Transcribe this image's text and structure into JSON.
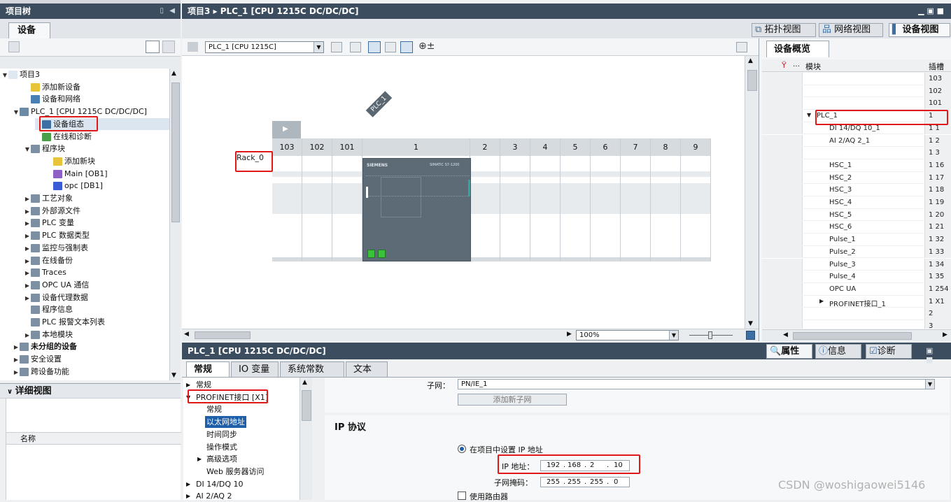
{
  "project_tree": {
    "title": "项目树",
    "tab": "设备",
    "items": [
      {
        "label": "项目3",
        "depth": 0,
        "toggle": "▼",
        "icon": "#dfe7f1"
      },
      {
        "label": "添加新设备",
        "depth": 2,
        "toggle": "",
        "icon": "#e8c43a"
      },
      {
        "label": "设备和网络",
        "depth": 2,
        "toggle": "",
        "icon": "#4a7fb3"
      },
      {
        "label": "PLC_1 [CPU 1215C DC/DC/DC]",
        "depth": 1,
        "toggle": "▼",
        "icon": "#6b8aa6"
      },
      {
        "label": "设备组态",
        "depth": 3,
        "toggle": "",
        "icon": "#3d6fa3"
      },
      {
        "label": "在线和诊断",
        "depth": 3,
        "toggle": "",
        "icon": "#4aa04a"
      },
      {
        "label": "程序块",
        "depth": 2,
        "toggle": "▼",
        "icon": "#7d8fa2"
      },
      {
        "label": "添加新块",
        "depth": 4,
        "toggle": "",
        "icon": "#e8c43a"
      },
      {
        "label": "Main [OB1]",
        "depth": 4,
        "toggle": "",
        "icon": "#8e5fc7"
      },
      {
        "label": "opc [DB1]",
        "depth": 4,
        "toggle": "",
        "icon": "#3b5bd6"
      },
      {
        "label": "工艺对象",
        "depth": 2,
        "toggle": "▶",
        "icon": "#7d8fa2"
      },
      {
        "label": "外部源文件",
        "depth": 2,
        "toggle": "▶",
        "icon": "#7d8fa2"
      },
      {
        "label": "PLC 变量",
        "depth": 2,
        "toggle": "▶",
        "icon": "#7d8fa2"
      },
      {
        "label": "PLC 数据类型",
        "depth": 2,
        "toggle": "▶",
        "icon": "#7d8fa2"
      },
      {
        "label": "监控与强制表",
        "depth": 2,
        "toggle": "▶",
        "icon": "#7d8fa2"
      },
      {
        "label": "在线备份",
        "depth": 2,
        "toggle": "▶",
        "icon": "#7d8fa2"
      },
      {
        "label": "Traces",
        "depth": 2,
        "toggle": "▶",
        "icon": "#7d8fa2"
      },
      {
        "label": "OPC UA 通信",
        "depth": 2,
        "toggle": "▶",
        "icon": "#7d8fa2"
      },
      {
        "label": "设备代理数据",
        "depth": 2,
        "toggle": "▶",
        "icon": "#7d8fa2"
      },
      {
        "label": "程序信息",
        "depth": 2,
        "toggle": "",
        "icon": "#7d8fa2"
      },
      {
        "label": "PLC 报警文本列表",
        "depth": 2,
        "toggle": "",
        "icon": "#7d8fa2"
      },
      {
        "label": "本地模块",
        "depth": 2,
        "toggle": "▶",
        "icon": "#7d8fa2"
      },
      {
        "label": "未分组的设备",
        "depth": 1,
        "toggle": "▶",
        "icon": "#7d8fa2",
        "bold": true
      },
      {
        "label": "安全设置",
        "depth": 1,
        "toggle": "▶",
        "icon": "#7d8fa2"
      },
      {
        "label": "跨设备功能",
        "depth": 1,
        "toggle": "▶",
        "icon": "#7d8fa2"
      }
    ]
  },
  "detail_view": {
    "title": "详细视图",
    "column_name": "名称"
  },
  "editor": {
    "title": "项目3 ▸ PLC_1 [CPU 1215C DC/DC/DC]",
    "views": [
      "拓扑视图",
      "网络视图",
      "设备视图"
    ],
    "device_select": "PLC_1 [CPU 1215C]",
    "plc_tag": "PLC_1",
    "rack_label": "Rack_0",
    "slots": [
      "103",
      "102",
      "101",
      "1",
      "2",
      "3",
      "4",
      "5",
      "6",
      "7",
      "8",
      "9"
    ],
    "zoom": "100%",
    "cpu_brand": "SIEMENS",
    "cpu_model": "SIMATIC S7-1200"
  },
  "overview": {
    "tab": "设备概览",
    "col_module": "模块",
    "col_slot": "插槽",
    "rows": [
      {
        "module": "",
        "slot": "103",
        "indent": 0,
        "toggle": ""
      },
      {
        "module": "",
        "slot": "102",
        "indent": 0,
        "toggle": ""
      },
      {
        "module": "",
        "slot": "101",
        "indent": 0,
        "toggle": ""
      },
      {
        "module": "PLC_1",
        "slot": "1",
        "indent": 0,
        "toggle": "▼"
      },
      {
        "module": "DI 14/DQ 10_1",
        "slot": "1 1",
        "indent": 1,
        "toggle": ""
      },
      {
        "module": "AI 2/AQ 2_1",
        "slot": "1 2",
        "indent": 1,
        "toggle": ""
      },
      {
        "module": "",
        "slot": "1 3",
        "indent": 1,
        "toggle": ""
      },
      {
        "module": "HSC_1",
        "slot": "1 16",
        "indent": 1,
        "toggle": ""
      },
      {
        "module": "HSC_2",
        "slot": "1 17",
        "indent": 1,
        "toggle": ""
      },
      {
        "module": "HSC_3",
        "slot": "1 18",
        "indent": 1,
        "toggle": ""
      },
      {
        "module": "HSC_4",
        "slot": "1 19",
        "indent": 1,
        "toggle": ""
      },
      {
        "module": "HSC_5",
        "slot": "1 20",
        "indent": 1,
        "toggle": ""
      },
      {
        "module": "HSC_6",
        "slot": "1 21",
        "indent": 1,
        "toggle": ""
      },
      {
        "module": "Pulse_1",
        "slot": "1 32",
        "indent": 1,
        "toggle": ""
      },
      {
        "module": "Pulse_2",
        "slot": "1 33",
        "indent": 1,
        "toggle": ""
      },
      {
        "module": "Pulse_3",
        "slot": "1 34",
        "indent": 1,
        "toggle": ""
      },
      {
        "module": "Pulse_4",
        "slot": "1 35",
        "indent": 1,
        "toggle": ""
      },
      {
        "module": "OPC UA",
        "slot": "1 254",
        "indent": 1,
        "toggle": ""
      },
      {
        "module": "PROFINET接口_1",
        "slot": "1 X1",
        "indent": 1,
        "toggle": "▶"
      },
      {
        "module": "",
        "slot": "2",
        "indent": 0,
        "toggle": ""
      },
      {
        "module": "",
        "slot": "3",
        "indent": 0,
        "toggle": ""
      }
    ]
  },
  "properties": {
    "title": "PLC_1 [CPU 1215C DC/DC/DC]",
    "right_tabs": [
      "属性",
      "信息",
      "诊断"
    ],
    "tabs": [
      "常规",
      "IO 变量",
      "系统常数",
      "文本"
    ],
    "nav": [
      {
        "label": "常规",
        "indent": 0,
        "toggle": "▶"
      },
      {
        "label": "PROFINET接口 [X1]",
        "indent": 0,
        "toggle": "▼"
      },
      {
        "label": "常规",
        "indent": 1,
        "toggle": ""
      },
      {
        "label": "以太网地址",
        "indent": 1,
        "toggle": "",
        "selected": true
      },
      {
        "label": "时间同步",
        "indent": 1,
        "toggle": ""
      },
      {
        "label": "操作模式",
        "indent": 1,
        "toggle": ""
      },
      {
        "label": "高级选项",
        "indent": 1,
        "toggle": "▶"
      },
      {
        "label": "Web 服务器访问",
        "indent": 1,
        "toggle": ""
      },
      {
        "label": "DI 14/DQ 10",
        "indent": 0,
        "toggle": "▶"
      },
      {
        "label": "AI 2/AQ 2",
        "indent": 0,
        "toggle": "▶"
      }
    ],
    "subnet_label": "子网：",
    "subnet_value": "PN/IE_1",
    "add_subnet": "添加新子网",
    "ip_section": "IP 协议",
    "radio_set_ip": "在项目中设置 IP 地址",
    "ip_label": "IP 地址：",
    "ip": [
      "192",
      "168",
      "2",
      "10"
    ],
    "mask_label": "子网掩码：",
    "mask": [
      "255",
      "255",
      "255",
      "0"
    ],
    "use_router": "使用路由器"
  },
  "watermark": "CSDN @woshigaowei5146"
}
